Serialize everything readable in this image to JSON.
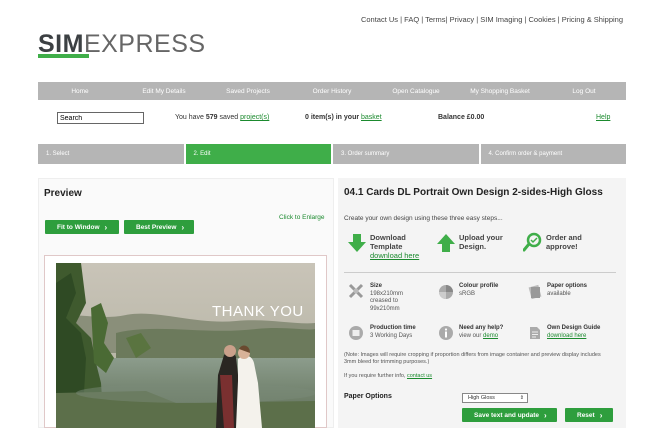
{
  "top_links": "Contact Us | FAQ | Terms| Privacy | SIM Imaging | Cookies | Pricing & Shipping",
  "logo": {
    "bold": "SIM",
    "light": "EXPRESS"
  },
  "nav": [
    "Home",
    "Edit My Details",
    "Saved Projects",
    "Order History",
    "Open Catalogue",
    "My Shopping Basket",
    "Log Out"
  ],
  "search": {
    "value": "Search"
  },
  "status": {
    "saved_prefix": "You have ",
    "saved_count": "579",
    "saved_mid": " saved ",
    "saved_link": "project(s)",
    "basket_prefix": "0 item(s) in your ",
    "basket_link": "basket",
    "balance": "Balance £0.00",
    "help": "Help"
  },
  "steps": [
    "1. Select",
    "2. Edit",
    "3. Order summary",
    "4. Confirm order & payment"
  ],
  "preview": {
    "title": "Preview",
    "enlarge": "Click to Enlarge",
    "fit_button": "Fit to Window",
    "best_button": "Best Preview",
    "card_text": "THANK YOU"
  },
  "product": {
    "title": "04.1 Cards DL Portrait Own Design 2-sides-High Gloss",
    "intro": "Create your own design using these three easy steps...",
    "step1_line1": "Download",
    "step1_line2": "Template",
    "step1_link": "download here",
    "step2_line1": "Upload your",
    "step2_line2": "Design.",
    "step3_line1": "Order and",
    "step3_line2": "approve!"
  },
  "features": {
    "size_title": "Size",
    "size_l1": "198x210mm",
    "size_l2": "creased to",
    "size_l3": "99x210mm",
    "colour_title": "Colour profile",
    "colour_val": "sRGB",
    "paper_title": "Paper options",
    "paper_val": "available",
    "prod_title": "Production time",
    "prod_val": "3 Working Days",
    "help_title": "Need any help?",
    "help_pre": "view our ",
    "help_link": "demo",
    "guide_title": "Own Design Guide",
    "guide_link": "download here"
  },
  "note": "(Note: Images will require cropping if proportion differs from image container and preview display includes 3mm bleed for trimming purposes.)",
  "further_pre": "If you require further info, ",
  "further_link": "contact us",
  "paper_options": {
    "label": "Paper Options",
    "selected": "High Gloss",
    "save_button": "Save text and update",
    "reset_button": "Reset"
  },
  "colors": {
    "accent": "#3fae49",
    "nav_grey": "#b5b5b5",
    "link": "#1b8a2e"
  }
}
